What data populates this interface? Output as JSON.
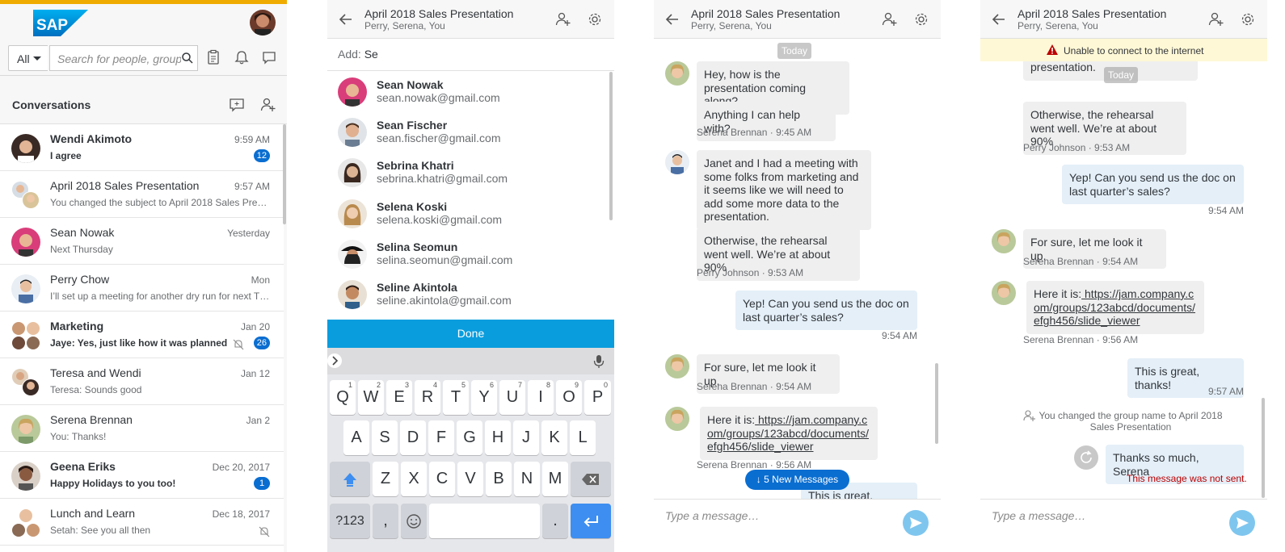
{
  "colors": {
    "accent": "#0a6ed1",
    "brand_bar": "#f0ab00",
    "done": "#0a9dde",
    "error": "#bb0000"
  },
  "p1": {
    "logo_text": "SAP",
    "filter": "All",
    "search_placeholder": "Search for people, groups",
    "section_title": "Conversations",
    "conversations": [
      {
        "name": "Wendi Akimoto",
        "time": "9:59 AM",
        "preview": "I agree",
        "badge": "12",
        "unread": true
      },
      {
        "name": "April 2018 Sales Presentation",
        "time": "9:57 AM",
        "preview": "You changed the subject to April 2018 Sales Presentation",
        "badge": "",
        "unread": false
      },
      {
        "name": "Sean Nowak",
        "time": "Yesterday",
        "preview": "Next Thursday",
        "badge": "",
        "unread": false
      },
      {
        "name": "Perry Chow",
        "time": "Mon",
        "preview": "I’ll set up a meeting for another dry run for next Thursday",
        "badge": "",
        "unread": false
      },
      {
        "name": "Marketing",
        "time": "Jan 20",
        "preview": "Jaye: Yes, just like how it was planned",
        "badge": "26",
        "unread": true
      },
      {
        "name": "Teresa and Wendi",
        "time": "Jan 12",
        "preview": "Teresa: Sounds good",
        "badge": "",
        "unread": false
      },
      {
        "name": "Serena Brennan",
        "time": "Jan 2",
        "preview": "You: Thanks!",
        "badge": "",
        "unread": false
      },
      {
        "name": "Geena Eriks",
        "time": "Dec 20, 2017",
        "preview": "Happy Holidays to you too!",
        "badge": "1",
        "unread": true
      },
      {
        "name": "Lunch and Learn",
        "time": "Dec 18, 2017",
        "preview": "Setah: See you all then",
        "badge": "",
        "unread": false
      }
    ]
  },
  "chat": {
    "title": "April 2018 Sales Presentation",
    "subtitle": "Perry, Serena, You",
    "compose_placeholder": "Type a message…"
  },
  "p2": {
    "add_label": "Add:",
    "add_value": "Se",
    "suggestions": [
      {
        "name": "Sean Nowak",
        "email": "sean.nowak@gmail.com"
      },
      {
        "name": "Sean Fischer",
        "email": "sean.fischer@gmail.com"
      },
      {
        "name": "Sebrina Khatri",
        "email": "sebrina.khatri@gmail.com"
      },
      {
        "name": "Selena Koski",
        "email": "selena.koski@gmail.com"
      },
      {
        "name": "Selina Seomun",
        "email": "selina.seomun@gmail.com"
      },
      {
        "name": "Seline Akintola",
        "email": "seline.akintola@gmail.com"
      }
    ],
    "done_label": "Done",
    "keyboard": {
      "row1": [
        "Q",
        "W",
        "E",
        "R",
        "T",
        "Y",
        "U",
        "I",
        "O",
        "P"
      ],
      "row1_digits": [
        "1",
        "2",
        "3",
        "4",
        "5",
        "6",
        "7",
        "8",
        "9",
        "0"
      ],
      "row2": [
        "A",
        "S",
        "D",
        "F",
        "G",
        "H",
        "J",
        "K",
        "L"
      ],
      "row3": [
        "Z",
        "X",
        "C",
        "V",
        "B",
        "N",
        "M"
      ],
      "sym": "?123",
      "comma": ",",
      "period": "."
    }
  },
  "p3": {
    "day": "Today",
    "m1a": "Hey, how is the presentation coming along?",
    "m1b": "Anything I can help with?",
    "m1_meta": "Serena Brennan · 9:45 AM",
    "m2a": "Janet and I had a meeting with some folks from marketing and it seems like we will need to add some more data to the presentation.",
    "m2b": "Otherwise, the rehearsal went well. We’re at about 90%",
    "m2_meta": "Perry Johnson · 9:53 AM",
    "m3": "Yep! Can you send us the doc on last quarter’s sales?",
    "m3_meta": "9:54 AM",
    "m4": "For sure, let me look it up.",
    "m4_meta": "Serena Brennan · 9:54 AM",
    "m5_pre": "Here it is:",
    "m5_link": " https://jam.company.com/groups/123abcd/documents/efgh456/slide_viewer",
    "m5_meta": "Serena Brennan · 9:56 AM",
    "m6": "This is great, thanks!",
    "new_messages": "5 New Messages"
  },
  "p4": {
    "warning": "Unable to connect to the internet",
    "m2a_tail": "seems like we will need to add some more data to the presentation.",
    "day": "Today",
    "m2b": "Otherwise, the rehearsal went well. We’re at about 90%",
    "m2_meta": "Perry Johnson · 9:53 AM",
    "m3": "Yep! Can you send us the doc on last quarter’s sales?",
    "m3_meta": "9:54 AM",
    "m4": "For sure, let me look it up.",
    "m4_meta": "Serena Brennan · 9:54 AM",
    "m5_pre": "Here it is:",
    "m5_link": " https://jam.company.com/groups/123abcd/documents/efgh456/slide_viewer",
    "m5_meta": "Serena Brennan · 9:56 AM",
    "m6": "This is great, thanks!",
    "m6_meta": "9:57 AM",
    "system": "You changed the group name to April 2018 Sales Presentation",
    "m7": "Thanks so much, Serena",
    "error": "This message was not sent."
  }
}
